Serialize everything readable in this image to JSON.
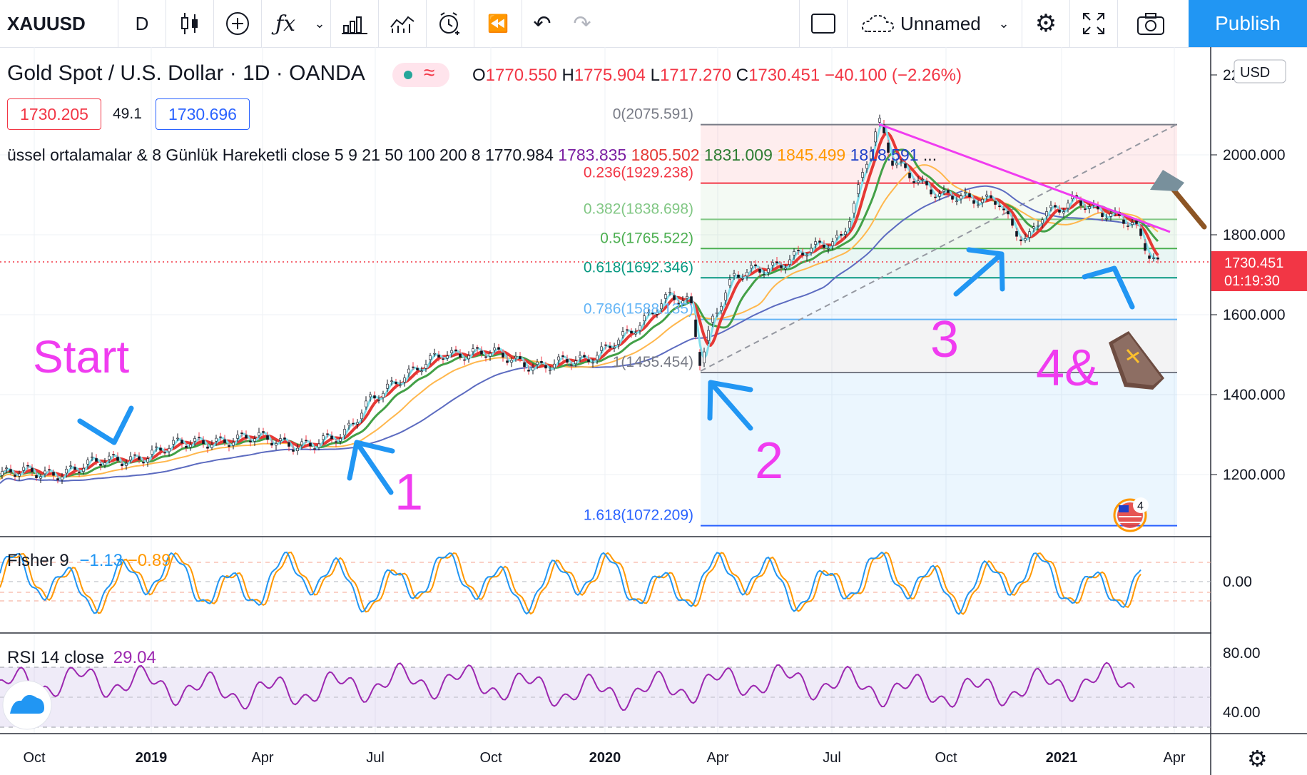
{
  "toolbar": {
    "symbol": "XAUUSD",
    "interval": "D",
    "layout_name": "Unnamed",
    "publish_label": "Publish"
  },
  "legend": {
    "title": "Gold Spot / U.S. Dollar · 1D · OANDA",
    "ohlc": {
      "o_label": "O",
      "o": "1770.550",
      "h_label": "H",
      "h": "1775.904",
      "l_label": "L",
      "l": "1717.270",
      "c_label": "C",
      "c": "1730.451",
      "change": "−40.100 (−2.26%)"
    },
    "bid": "1730.205",
    "spread": "49.1",
    "ask": "1730.696",
    "ma_study": "üssel ortalamalar & 8 Günlük Hareketli close 5 9 21 50 100 200 8",
    "ma_values": [
      {
        "value": "1770.984",
        "color": "#131722"
      },
      {
        "value": "1783.835",
        "color": "#7b1fa2"
      },
      {
        "value": "1805.502",
        "color": "#e53935"
      },
      {
        "value": "1831.009",
        "color": "#2e7d32"
      },
      {
        "value": "1845.499",
        "color": "#ff9800"
      },
      {
        "value": "1818.591",
        "color": "#1e40c8"
      }
    ],
    "more": "..."
  },
  "price_scale": {
    "currency": "USD",
    "ticks": [
      "2200.000",
      "2000.000",
      "1800.000",
      "1600.000",
      "1400.000",
      "1200.000"
    ],
    "last_price": "1730.451",
    "countdown": "01:19:30"
  },
  "fib": [
    {
      "label": "0(2075.591)",
      "price": 2075.591,
      "color": "#787b86"
    },
    {
      "label": "0.236(1929.238)",
      "price": 1929.238,
      "color": "#f23645"
    },
    {
      "label": "0.382(1838.698)",
      "price": 1838.698,
      "color": "#81c784"
    },
    {
      "label": "0.5(1765.522)",
      "price": 1765.522,
      "color": "#4caf50"
    },
    {
      "label": "0.618(1692.346)",
      "price": 1692.346,
      "color": "#089981"
    },
    {
      "label": "0.786(1588.135)",
      "price": 1588.135,
      "color": "#64b5f6"
    },
    {
      "label": "1(1455.454)",
      "price": 1455.454,
      "color": "#787b86"
    },
    {
      "label": "1.618(1072.209)",
      "price": 1072.209,
      "color": "#2962ff"
    }
  ],
  "annotations": {
    "start": "Start",
    "n1": "1",
    "n2": "2",
    "n3": "3",
    "n4": "4&",
    "events_count": "4"
  },
  "fisher": {
    "label": "Fisher 9",
    "v1": "−1.13",
    "v2": "−0.89",
    "tick": "0.00"
  },
  "rsi": {
    "label": "RSI 14 close",
    "value": "29.04",
    "ticks": [
      "80.00",
      "40.00"
    ]
  },
  "time_axis": [
    "Oct",
    "2019",
    "Apr",
    "Jul",
    "Oct",
    "2020",
    "Apr",
    "Jul",
    "Oct",
    "2021",
    "Apr"
  ],
  "colors": {
    "accent": "#2196f3",
    "annotation": "#f03cf0",
    "arrow": "#2196f3",
    "down": "#f23645"
  }
}
